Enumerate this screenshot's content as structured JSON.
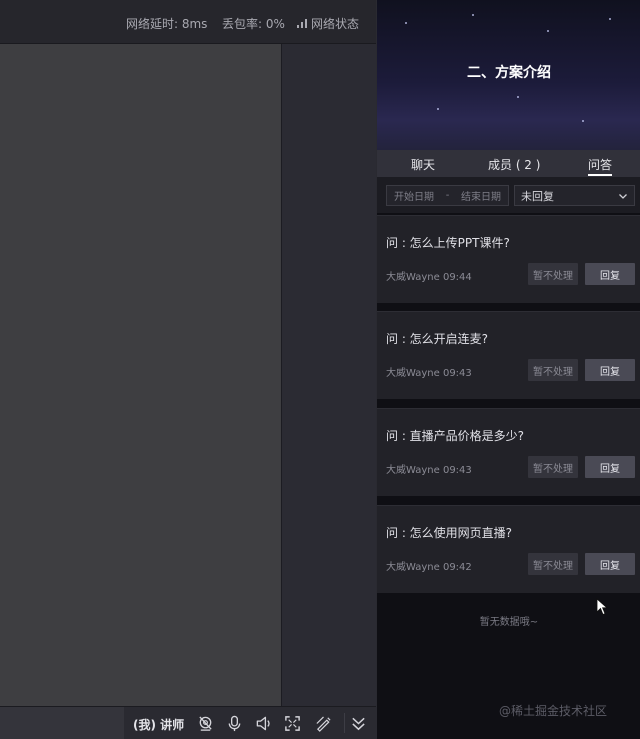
{
  "status_bar": {
    "latency": "网络延时: 8ms",
    "packet_loss": "丢包率: 0%",
    "network_status": "网络状态",
    "network_icon": "signal-bars-icon"
  },
  "toolbar": {
    "role_label": "(我) 讲师",
    "icons": [
      "camera-off-icon",
      "microphone-icon",
      "speaker-icon",
      "fullscreen-icon",
      "pen-icon",
      "chevron-double-down-icon"
    ]
  },
  "panel": {
    "banner_title": "二、方案介绍",
    "tabs": [
      {
        "label": "聊天"
      },
      {
        "label": "成员 ( 2 )"
      },
      {
        "label": "问答"
      }
    ],
    "active_tab": "问答",
    "filter": {
      "start_date": "开始日期",
      "separator": "-",
      "end_date": "结束日期",
      "status_value": "未回复"
    },
    "questions": [
      {
        "text": "问 : 怎么上传PPT课件?",
        "author_time": "大威Wayne 09:44",
        "hold_label": "暂不处理",
        "reply_label": "回复"
      },
      {
        "text": "问 : 怎么开启连麦?",
        "author_time": "大威Wayne 09:43",
        "hold_label": "暂不处理",
        "reply_label": "回复"
      },
      {
        "text": "问 : 直播产品价格是多少?",
        "author_time": "大威Wayne 09:43",
        "hold_label": "暂不处理",
        "reply_label": "回复"
      },
      {
        "text": "问 : 怎么使用网页直播?",
        "author_time": "大威Wayne 09:42",
        "hold_label": "暂不处理",
        "reply_label": "回复"
      }
    ],
    "empty_note": "暂无数据哦~",
    "watermark": "@稀土掘金技术社区"
  },
  "colors": {
    "background": "#0d0d12",
    "stage": "#3e3e41",
    "tab_active_underline": "#ffffff",
    "reply_button": "#4a4a55"
  }
}
